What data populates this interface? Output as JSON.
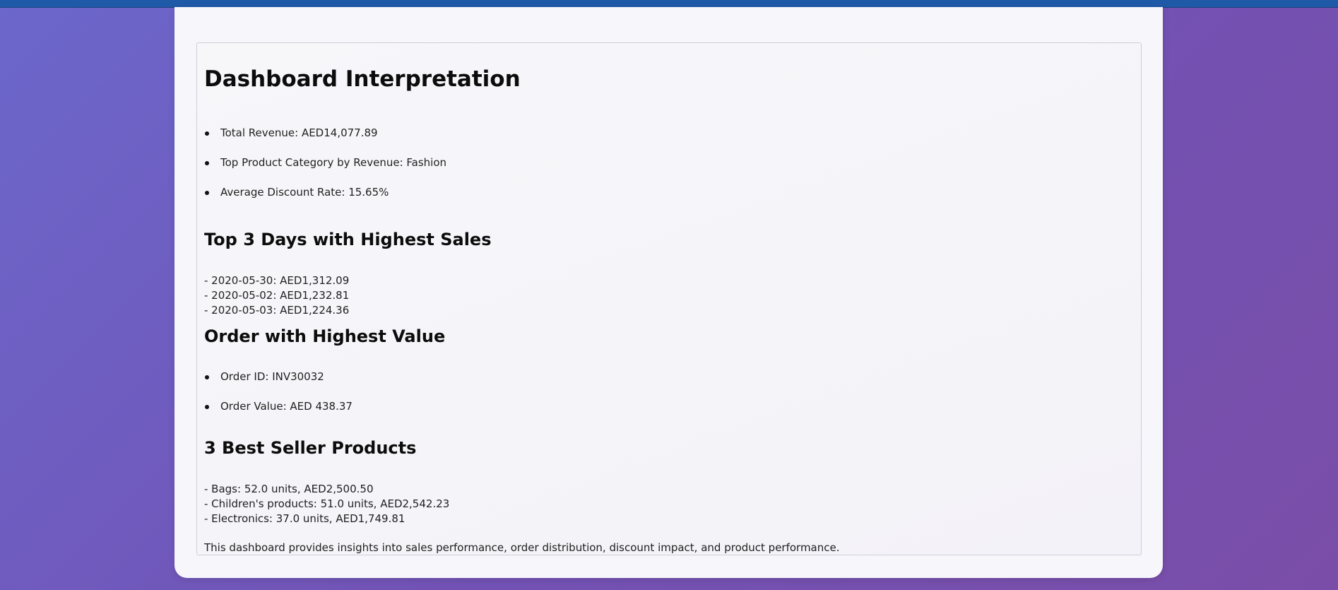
{
  "dashboard": {
    "title": "Dashboard Interpretation",
    "summary_items": [
      "Total Revenue: AED14,077.89",
      "Top Product Category by Revenue: Fashion",
      "Average Discount Rate: 15.65%"
    ],
    "top_days": {
      "heading": "Top 3 Days with Highest Sales",
      "lines": [
        "- 2020-05-30: AED1,312.09",
        "- 2020-05-02: AED1,232.81",
        "- 2020-05-03: AED1,224.36"
      ]
    },
    "highest_order": {
      "heading": "Order with Highest Value",
      "items": [
        "Order ID: INV30032",
        "Order Value: AED 438.37"
      ]
    },
    "best_sellers": {
      "heading": "3 Best Seller Products",
      "lines": [
        "- Bags: 52.0 units, AED2,500.50",
        "- Children's products: 51.0 units, AED2,542.23",
        "- Electronics: 37.0 units, AED1,749.81"
      ]
    },
    "footer_note": "This dashboard provides insights into sales performance, order distribution, discount impact, and product performance."
  }
}
